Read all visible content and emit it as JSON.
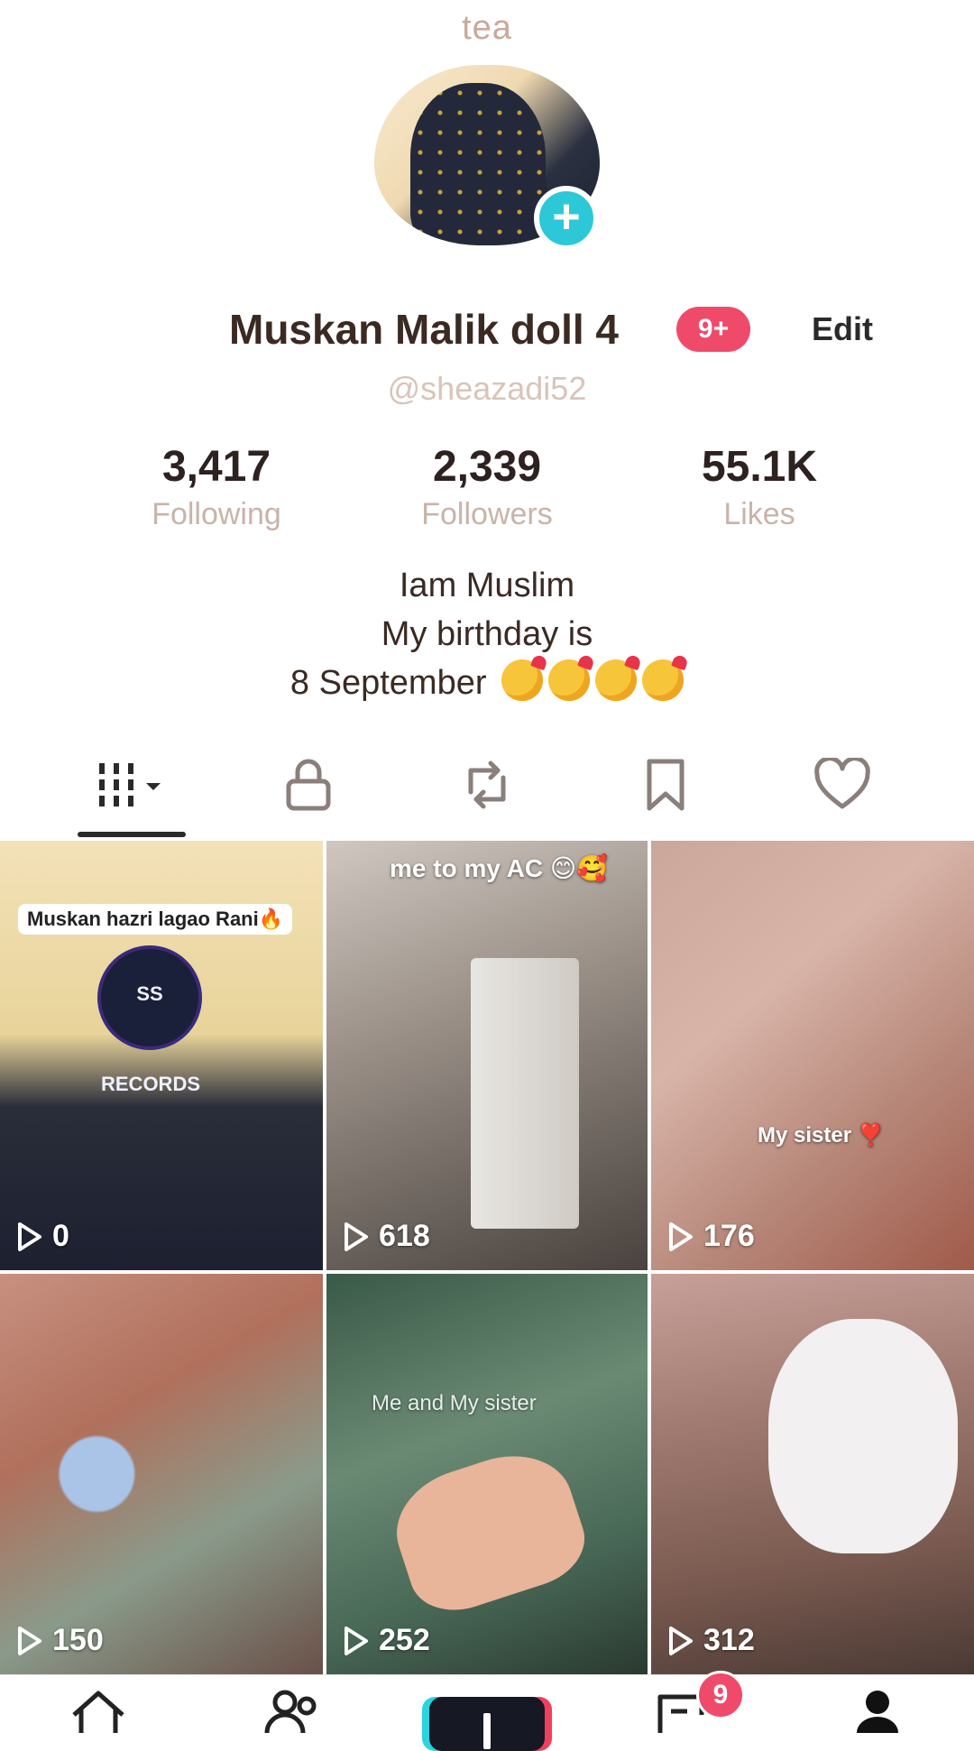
{
  "profile": {
    "top_title": "tea",
    "display_name": "Muskan Malik doll 4",
    "badge": "9+",
    "edit_label": "Edit",
    "handle": "@sheazadi52"
  },
  "stats": [
    {
      "value": "3,417",
      "label": "Following"
    },
    {
      "value": "2,339",
      "label": "Followers"
    },
    {
      "value": "55.1K",
      "label": "Likes"
    }
  ],
  "bio": {
    "line1": "Iam Muslim",
    "line2": "My birthday is",
    "line3": "8 September"
  },
  "tabs": [
    {
      "icon": "grid-icon"
    },
    {
      "icon": "lock-icon"
    },
    {
      "icon": "repost-icon"
    },
    {
      "icon": "bookmark-icon"
    },
    {
      "icon": "heart-icon"
    }
  ],
  "videos": [
    {
      "views": "0",
      "caption": "Muskan hazri lagao Rani🔥",
      "inner_label": "SS RECORDS"
    },
    {
      "views": "618",
      "caption": "me to my AC 😊🥰"
    },
    {
      "views": "176",
      "caption": "My sister ❣️"
    },
    {
      "views": "150"
    },
    {
      "views": "252",
      "caption": "Me and My sister"
    },
    {
      "views": "312"
    }
  ],
  "bottom_nav": {
    "notification_count": "9"
  }
}
